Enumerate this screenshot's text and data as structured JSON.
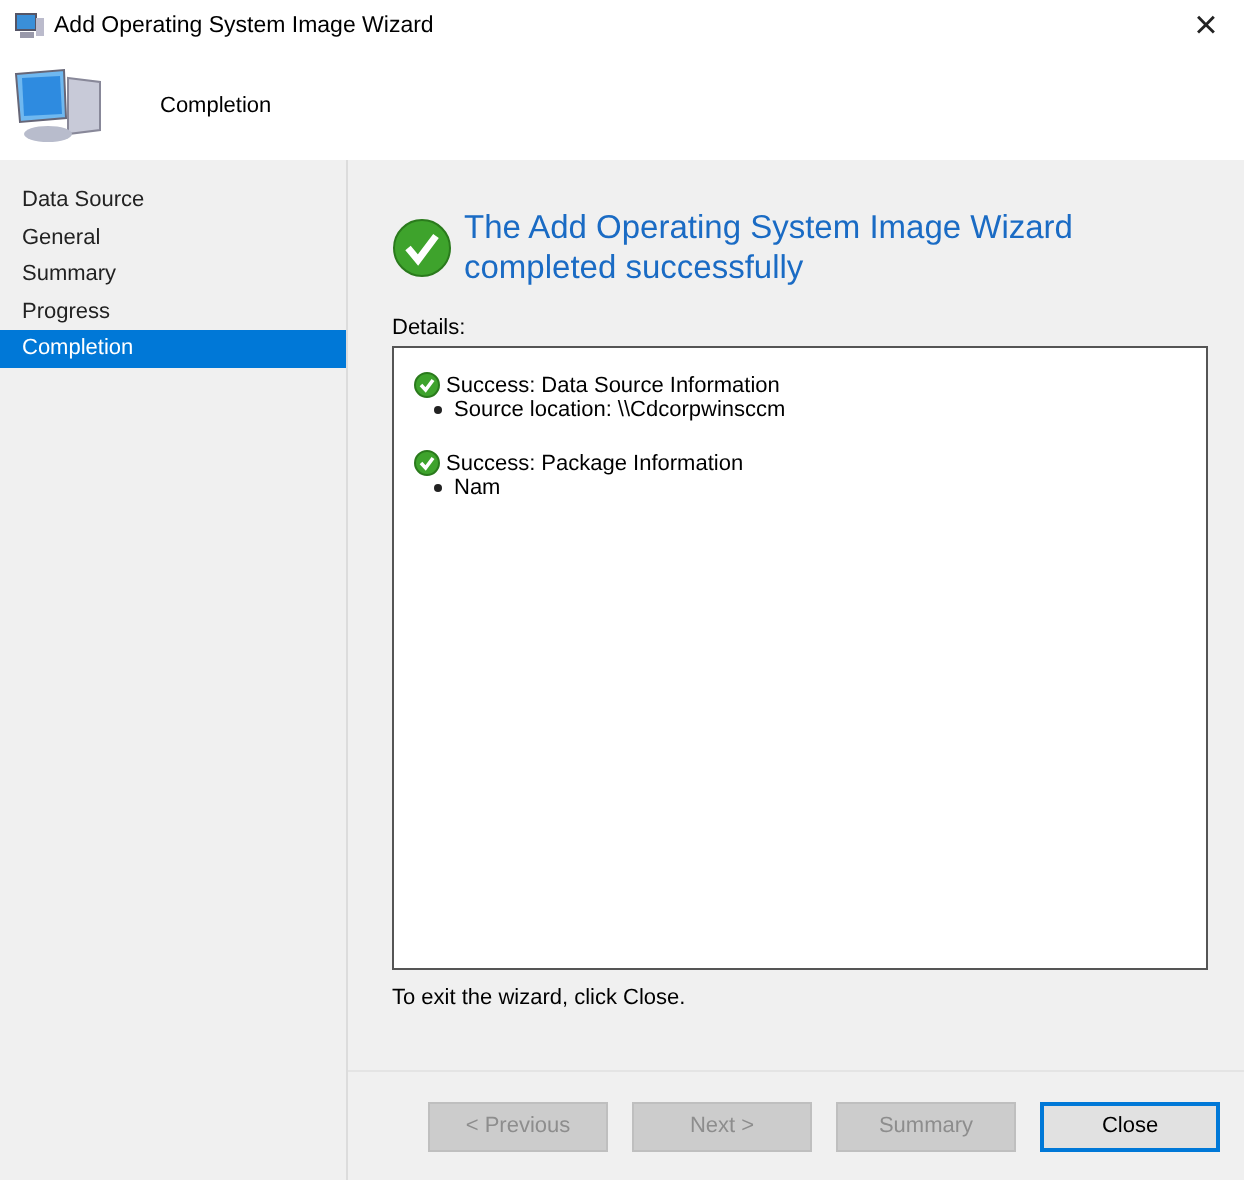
{
  "window": {
    "title": "Add Operating System Image Wizard",
    "close": "×"
  },
  "header": {
    "title": "Completion"
  },
  "sidebar": {
    "items": [
      {
        "label": "Data Source",
        "selected": false
      },
      {
        "label": "General",
        "selected": false
      },
      {
        "label": "Summary",
        "selected": false
      },
      {
        "label": "Progress",
        "selected": false
      },
      {
        "label": "Completion",
        "selected": true
      }
    ]
  },
  "result": {
    "heading": "The Add Operating System Image Wizard completed successfully"
  },
  "details": {
    "label": "Details:",
    "entries": [
      {
        "title": "Success: Data Source Information",
        "bullets": [
          "Source location: \\\\Cdcorpwinsccm"
        ]
      },
      {
        "title": "Success: Package Information",
        "bullets": [
          "Nam"
        ]
      }
    ]
  },
  "exit_hint": "To exit the wizard, click Close.",
  "buttons": [
    {
      "label": "< Previous",
      "disabled": true,
      "default": false
    },
    {
      "label": "Next >",
      "disabled": true,
      "default": false
    },
    {
      "label": "Summary",
      "disabled": true,
      "default": false
    },
    {
      "label": "Close",
      "disabled": false,
      "default": true
    }
  ]
}
